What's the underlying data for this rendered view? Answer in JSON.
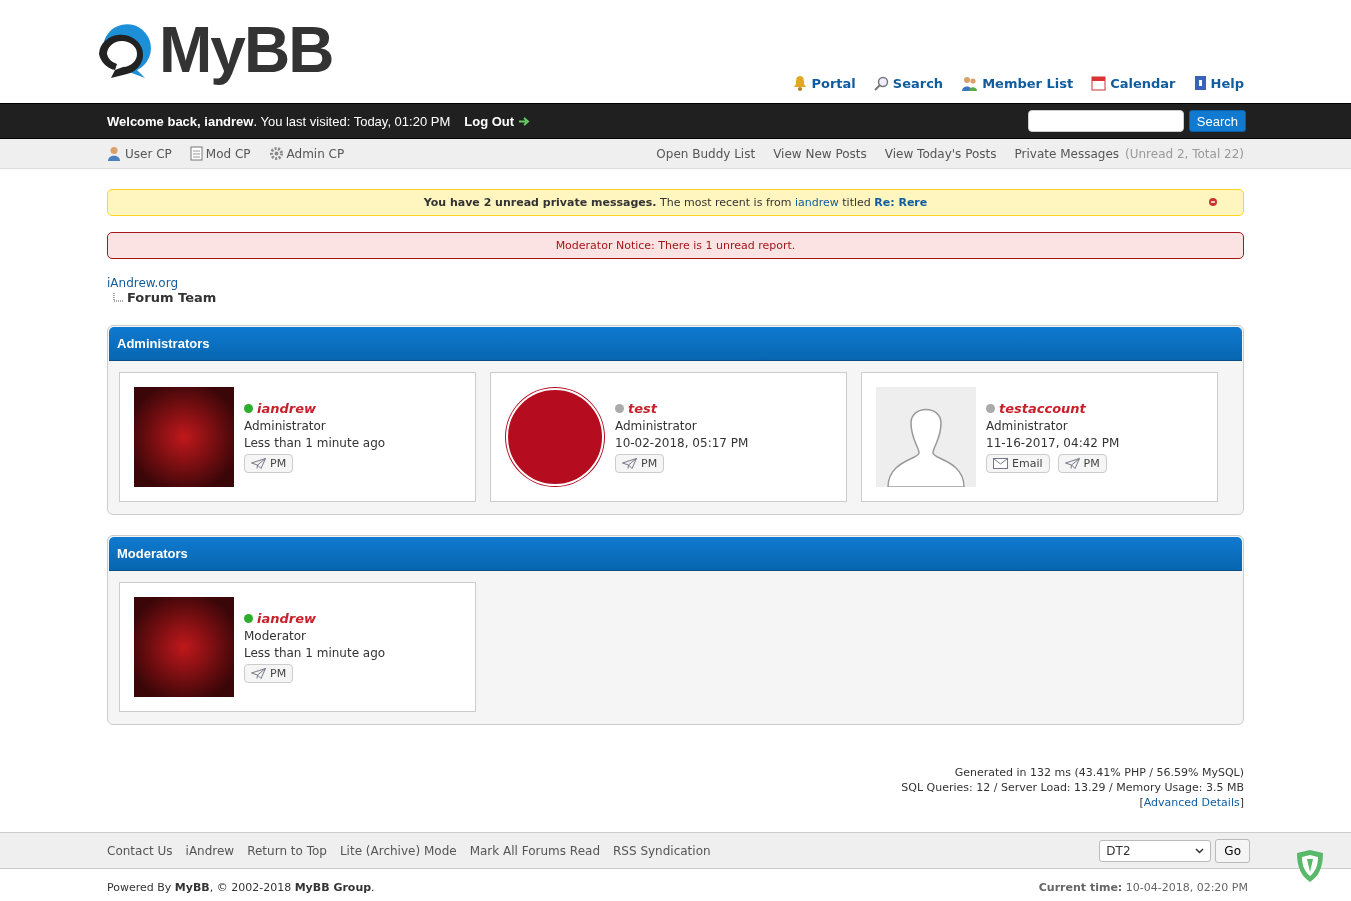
{
  "logo": {
    "text": "MyBB"
  },
  "top_links": [
    {
      "kind": "portal",
      "label": "Portal"
    },
    {
      "kind": "search",
      "label": "Search"
    },
    {
      "kind": "members",
      "label": "Member List"
    },
    {
      "kind": "calendar",
      "label": "Calendar"
    },
    {
      "kind": "help",
      "label": "Help"
    }
  ],
  "welcome": {
    "text": "**Welcome back, iandrew**. You last visited: Today, 01:20 PM",
    "logout": "Log Out",
    "search_button": "Search"
  },
  "user_links": [
    {
      "kind": "user",
      "label": "User CP"
    },
    {
      "kind": "mod",
      "label": "Mod CP"
    },
    {
      "kind": "admin",
      "label": "Admin CP"
    }
  ],
  "right_links": [
    {
      "label": "Open Buddy List"
    },
    {
      "label": "View New Posts"
    },
    {
      "label": "View Today's Posts"
    }
  ],
  "private_messages": {
    "label": "Private Messages",
    "counts": "(Unread 2, Total 22)"
  },
  "pm_notice": {
    "bold": "You have 2 unread private messages.",
    "text1": "The most recent is from",
    "from": "iandrew",
    "text2": "titled",
    "title": "Re: Rere"
  },
  "mod_notice": "Moderator Notice: There is 1 unread report.",
  "breadcrumb": {
    "root": "iAndrew.org",
    "current": "Forum Team"
  },
  "groups": [
    {
      "title": "Administrators",
      "members": [
        {
          "name": "iandrew",
          "online": true,
          "kind": "image",
          "role": "Administrator",
          "last": "Less than 1 minute ago",
          "buttons": [
            {
              "kind": "pm",
              "label": "PM"
            }
          ]
        },
        {
          "name": "test",
          "online": false,
          "kind": "logo",
          "role": "Administrator",
          "last": "10-02-2018, 05:17 PM",
          "buttons": [
            {
              "kind": "pm",
              "label": "PM"
            }
          ]
        },
        {
          "name": "testaccount",
          "online": false,
          "kind": "default",
          "role": "Administrator",
          "last": "11-16-2017, 04:42 PM",
          "buttons": [
            {
              "kind": "email",
              "label": "Email"
            },
            {
              "kind": "pm",
              "label": "PM"
            }
          ]
        }
      ]
    },
    {
      "title": "Moderators",
      "members": [
        {
          "name": "iandrew",
          "online": true,
          "kind": "image",
          "role": "Moderator",
          "last": "Less than 1 minute ago",
          "buttons": [
            {
              "kind": "pm",
              "label": "PM"
            }
          ]
        }
      ]
    }
  ],
  "debug": {
    "line1": "Generated in 132 ms (43.41% PHP / 56.59% MySQL)",
    "line2": "SQL Queries: 12 / Server Load: 13.29 / Memory Usage: 3.5 MB",
    "open": "[",
    "link": "Advanced Details",
    "close": "]"
  },
  "footer_links": [
    "Contact Us",
    "iAndrew",
    "Return to Top",
    "Lite (Archive) Mode",
    "Mark All Forums Read",
    "RSS Syndication"
  ],
  "theme_select": {
    "value": "DT2",
    "button": "Go"
  },
  "copyright": "Powered By **MyBB**, © 2002-2018 **MyBB Group**.",
  "current_time": "**Current time:** 10-04-2018, 02:20 PM"
}
